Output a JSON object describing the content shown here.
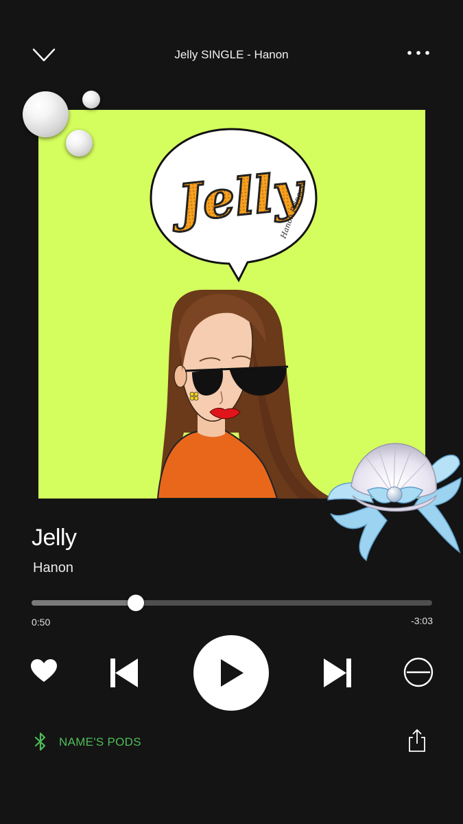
{
  "header": {
    "title": "Jelly SINGLE - Hanon",
    "collapse_icon": "chevron-down-icon",
    "menu_icon": "more-dots-icon"
  },
  "artwork": {
    "bubble_text": "Jelly",
    "bubble_subtext": "Hanon Princess",
    "background": "#d4fd5e"
  },
  "track": {
    "title": "Jelly",
    "artist": "Hanon"
  },
  "progress": {
    "elapsed": "0:50",
    "remaining": "-3:03",
    "fraction": 0.26
  },
  "controls": {
    "like_icon": "heart-icon",
    "prev_icon": "skip-previous-icon",
    "play_icon": "play-icon",
    "next_icon": "skip-next-icon",
    "block_icon": "block-icon"
  },
  "footer": {
    "device": "NAME'S PODS",
    "device_color": "#4fbd59",
    "bluetooth_icon": "bluetooth-icon",
    "share_icon": "share-icon"
  }
}
